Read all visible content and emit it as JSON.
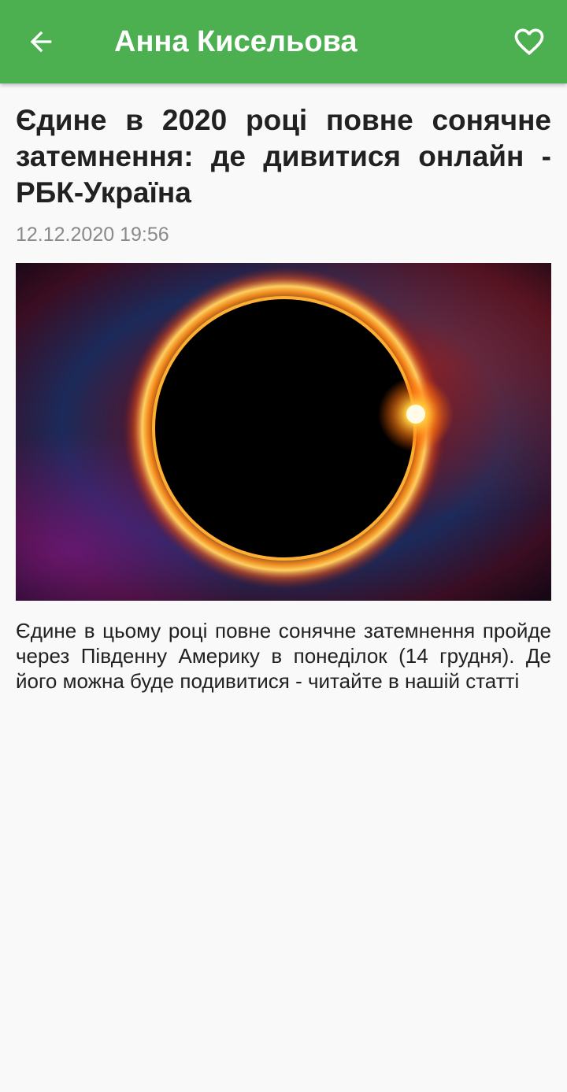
{
  "appbar": {
    "title": "Анна Кисельова",
    "back_icon": "arrow-back-icon",
    "favorite_icon": "heart-outline-icon",
    "background_color": "#4caf50"
  },
  "article": {
    "title": "Єдине в 2020 році повне сонячне затемнення: де дивитися онлайн - РБК-Україна",
    "date": "12.12.2020 19:56",
    "image_subject": "total solar eclipse",
    "summary": "Єдине в цьому році повне сонячне затемнення пройде через Південну Америку в понеділок (14 грудня). Де його можна буде подивитися - читайте в нашій статті"
  }
}
